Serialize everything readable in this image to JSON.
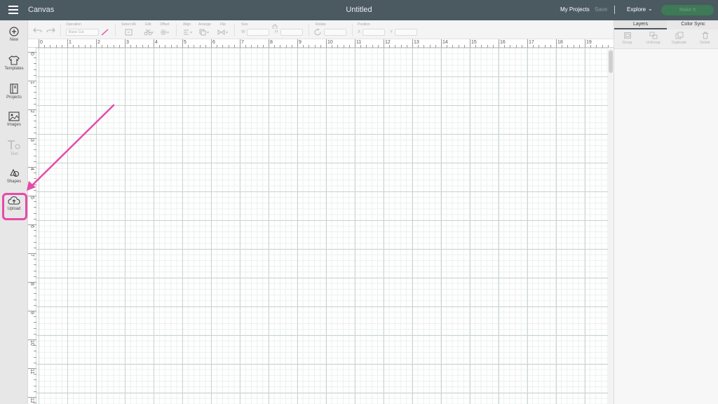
{
  "topbar": {
    "app_title": "Canvas",
    "document_title": "Untitled",
    "my_projects": "My Projects",
    "save": "Save",
    "explore": "Explore",
    "explore_chevron": "⌄",
    "make_it": "Make It"
  },
  "sidebar": {
    "items": [
      {
        "label": "New",
        "icon": "plus-circle-icon"
      },
      {
        "label": "Templates",
        "icon": "tshirt-icon"
      },
      {
        "label": "Projects",
        "icon": "notebook-icon"
      },
      {
        "label": "Images",
        "icon": "image-icon"
      },
      {
        "label": "Text",
        "icon": "text-icon"
      },
      {
        "label": "Shapes",
        "icon": "shapes-icon"
      },
      {
        "label": "Upload",
        "icon": "cloud-upload-icon"
      }
    ],
    "highlight_color": "#e64aa8"
  },
  "toolbar": {
    "operation_label": "Operation",
    "operation_value": "Basic Cut",
    "select_all_label": "Select All",
    "edit_label": "Edit",
    "offset_label": "Offset",
    "align_label": "Align",
    "arrange_label": "Arrange",
    "flip_label": "Flip",
    "size_label": "Size",
    "width_letter": "W",
    "height_letter": "H",
    "rotate_label": "Rotate",
    "position_label": "Position",
    "x_letter": "X",
    "y_letter": "Y"
  },
  "right_panel": {
    "tabs": [
      "Layers",
      "Color Sync"
    ],
    "actions": [
      "Group",
      "UnGroup",
      "Duplicate",
      "Delete"
    ]
  },
  "rulers": {
    "top": [
      "0",
      "1",
      "2",
      "3",
      "4",
      "5",
      "6",
      "7",
      "8",
      "9",
      "10",
      "11",
      "12",
      "13",
      "14",
      "15",
      "16",
      "17",
      "18",
      "19"
    ],
    "left": [
      "0",
      "1",
      "2",
      "3",
      "4",
      "5",
      "6",
      "7",
      "8",
      "9",
      "10",
      "11",
      "12"
    ]
  },
  "colors": {
    "topbar": "#4b5961",
    "accent_pink": "#e64aa8",
    "make_it_green": "#3d7a55"
  }
}
